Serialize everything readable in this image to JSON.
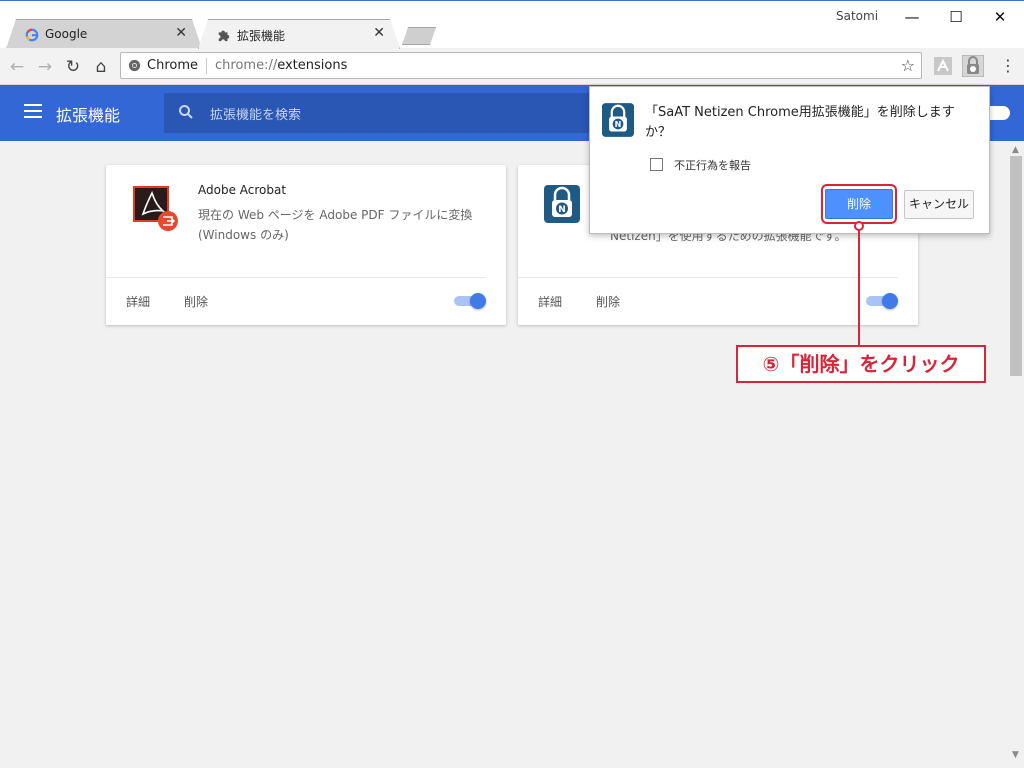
{
  "window": {
    "profile_name": "Satomi",
    "minimize_label": "—",
    "maximize_label": "☐",
    "close_label": "✕"
  },
  "tabs": [
    {
      "title": "Google",
      "close": "✕",
      "icon": "google-g-icon"
    },
    {
      "title": "拡張機能",
      "close": "✕",
      "icon": "puzzle-icon"
    }
  ],
  "toolbar": {
    "back": "←",
    "forward": "→",
    "reload": "↻",
    "home": "⌂",
    "chip_label": "Chrome",
    "url_scheme": "chrome://",
    "url_path": "extensions",
    "star": "☆",
    "menu": "⋮"
  },
  "header": {
    "title": "拡張機能",
    "search_placeholder": "拡張機能を検索"
  },
  "extensions": [
    {
      "name": "Adobe Acrobat",
      "description": "現在の Web ページを Adobe PDF ファイルに変換 (Windows のみ)",
      "details_label": "詳細",
      "remove_label": "削除",
      "enabled": true
    },
    {
      "name": "",
      "description": "Netizen」を使用するための拡張機能です。",
      "details_label": "詳細",
      "remove_label": "削除",
      "enabled": true
    }
  ],
  "dialog": {
    "message": "「SaAT Netizen Chrome用拡張機能」を削除しますか？",
    "checkbox_label": "不正行為を報告",
    "checkbox_checked": false,
    "remove_label": "削除",
    "cancel_label": "キャンセル"
  },
  "annotation": {
    "text": "⑤「削除」をクリック"
  },
  "colors": {
    "header_blue": "#3367d6",
    "accent_red": "#d9253a",
    "primary_button": "#4d90fe"
  }
}
